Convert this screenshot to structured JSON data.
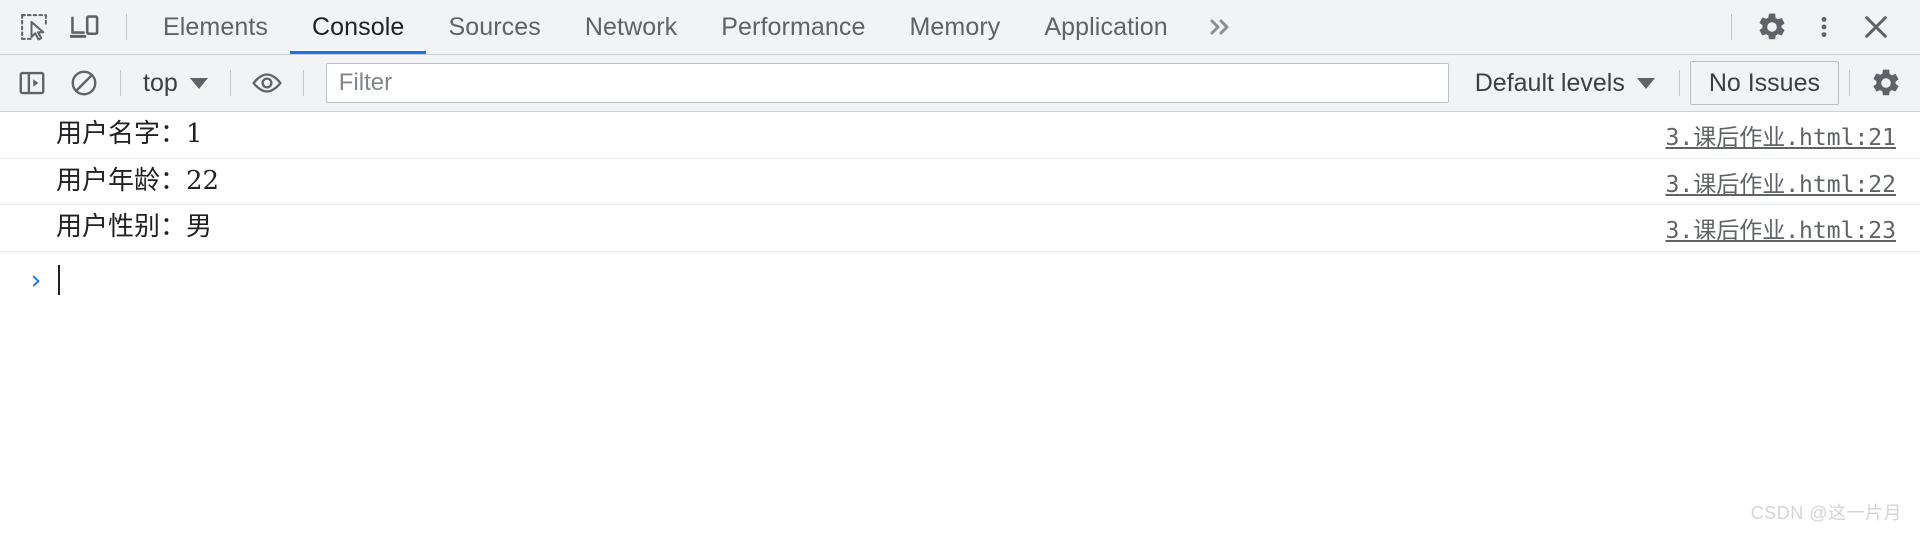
{
  "window": {
    "title": "Chrome DevTools - Console"
  },
  "tabbar": {
    "inspect_icon": "inspect-element-icon",
    "device_icon": "device-toolbar-icon",
    "tabs": [
      {
        "label": "Elements",
        "active": false
      },
      {
        "label": "Console",
        "active": true
      },
      {
        "label": "Sources",
        "active": false
      },
      {
        "label": "Network",
        "active": false
      },
      {
        "label": "Performance",
        "active": false
      },
      {
        "label": "Memory",
        "active": false
      },
      {
        "label": "Application",
        "active": false
      }
    ],
    "more_tabs_label": "»",
    "settings_icon": "gear-icon",
    "menu_icon": "kebab-menu-icon",
    "close_icon": "close-icon",
    "active_tab_accent": "#1a73e8"
  },
  "console_toolbar": {
    "sidebar_toggle_icon": "console-sidebar-icon",
    "clear_console_icon": "clear-console-icon",
    "context": {
      "label": "top",
      "caret": "chevron-down-icon"
    },
    "live_expression_icon": "eye-icon",
    "filter": {
      "value": "",
      "placeholder": "Filter"
    },
    "levels": {
      "label": "Default levels",
      "caret": "chevron-down-icon"
    },
    "issues_button": {
      "label": "No Issues"
    },
    "settings_icon": "gear-icon"
  },
  "console": {
    "messages": [
      {
        "text": "用户名字：1",
        "source": "3.课后作业.html:21"
      },
      {
        "text": "用户年龄：22",
        "source": "3.课后作业.html:22"
      },
      {
        "text": "用户性别：男",
        "source": "3.课后作业.html:23"
      }
    ],
    "prompt": {
      "chevron": "›",
      "input_value": ""
    }
  },
  "watermark": {
    "text": "CSDN @这一片月"
  }
}
